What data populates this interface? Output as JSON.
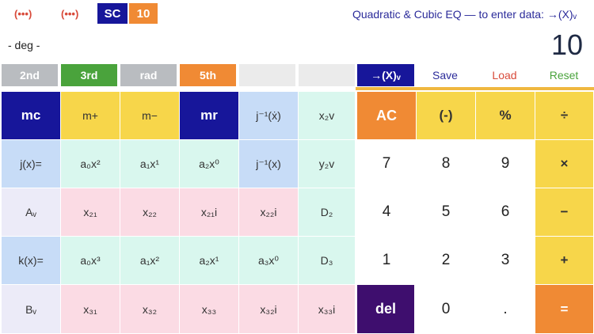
{
  "header": {
    "dots_1": "(•••)",
    "dots_2": "(•••)",
    "sc_badge": "SC",
    "mode_badge": "10",
    "hint": "Quadratic & Cubic EQ — to enter data: →(X)ᵥ",
    "angle_mode": "- deg -",
    "display_value": "10"
  },
  "function_tabs": [
    "2nd",
    "3rd",
    "rad",
    "5th",
    "",
    ""
  ],
  "action_bar": {
    "enter_label": "→(X)ᵥ",
    "save_label": "Save",
    "load_label": "Load",
    "reset_label": "Reset"
  },
  "keypad": {
    "row1": [
      "mc",
      "m+",
      "m−",
      "mr",
      "j⁻¹(ẋ)",
      "x₂v",
      "AC",
      "(-)",
      "%",
      "÷"
    ],
    "row2": [
      "j(x)=",
      "a₀x²",
      "a₁x¹",
      "a₂x⁰",
      "j⁻¹(x)",
      "y₂v",
      "7",
      "8",
      "9",
      "×"
    ],
    "row3": [
      "Aᵥ",
      "x₂₁",
      "x₂₂",
      "x₂₁i",
      "x₂₂i",
      "D₂",
      "4",
      "5",
      "6",
      "−"
    ],
    "row4": [
      "k(x)=",
      "a₀x³",
      "a₁x²",
      "a₂x¹",
      "a₃x⁰",
      "D₃",
      "1",
      "2",
      "3",
      "+"
    ],
    "row5": [
      "Bᵥ",
      "x₃₁",
      "x₃₂",
      "x₃₃",
      "x₃₂i",
      "x₃₃i",
      "del",
      "0",
      ".",
      "="
    ]
  },
  "colors": {
    "navy": "#17169a",
    "orange": "#f08a34",
    "yellow": "#f7d64a",
    "green": "#4aa33c",
    "gray": "#b9bcc0",
    "purple": "#3e0e6e",
    "blue_cell": "#c7dcf7",
    "mint_cell": "#d9f7ee",
    "pink_cell": "#fbdbe4",
    "lavender_cell": "#ecebf8"
  }
}
